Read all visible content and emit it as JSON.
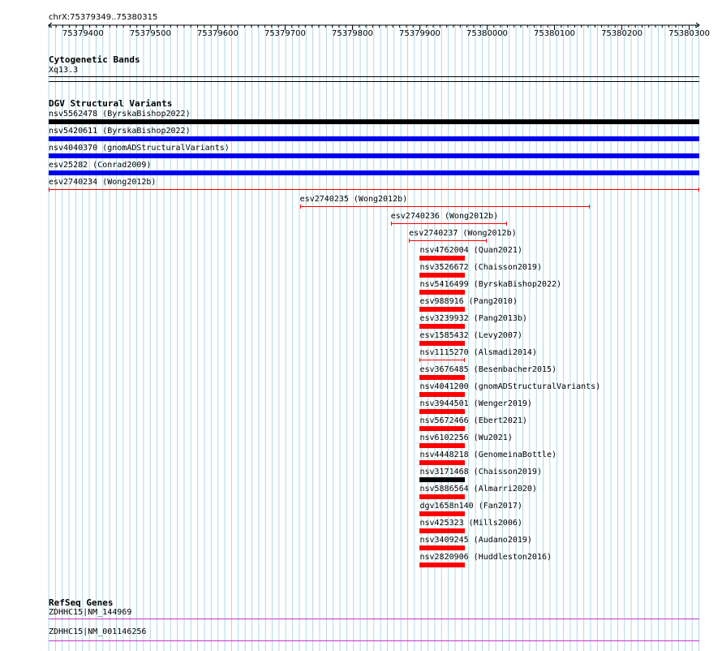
{
  "location": "chrX:75379349..75380315",
  "ruler": {
    "ticks": [
      "75379400",
      "75379500",
      "75379600",
      "75379700",
      "75379800",
      "75379900",
      "75380000",
      "75380100",
      "75380200",
      "75380300"
    ]
  },
  "colors": {
    "red": "#ff0000",
    "blue": "#0000ee",
    "black": "#000000",
    "gene": "#cc33cc",
    "grid": "#add8e6"
  },
  "tracks": {
    "cytoband": {
      "title": "Cytogenetic Bands",
      "label": "Xq13.3"
    },
    "dgv": {
      "title": "DGV Structural Variants",
      "features": [
        {
          "label": "nsv5562478 (ByrskaBishop2022)",
          "style": "thick",
          "color": "black",
          "start": 75379349,
          "end": 75380315
        },
        {
          "label": "nsv5420611 (ByrskaBishop2022)",
          "style": "thick",
          "color": "blue",
          "start": 75379349,
          "end": 75380315
        },
        {
          "label": "nsv4040370 (gnomADStructuralVariants)",
          "style": "thick",
          "color": "blue",
          "start": 75379349,
          "end": 75380315
        },
        {
          "label": "esv25282 (Conrad2009)",
          "style": "thick",
          "color": "blue",
          "start": 75379349,
          "end": 75380315
        },
        {
          "label": "esv2740234 (Wong2012b)",
          "style": "thin",
          "color": "red",
          "start": 75379349,
          "end": 75380315
        },
        {
          "label": "esv2740235 (Wong2012b)",
          "style": "thin",
          "color": "red",
          "start": 75379722,
          "end": 75380152
        },
        {
          "label": "esv2740236 (Wong2012b)",
          "style": "thin",
          "color": "red",
          "start": 75379857,
          "end": 75380030
        },
        {
          "label": "esv2740237 (Wong2012b)",
          "style": "thin",
          "color": "red",
          "start": 75379884,
          "end": 75380000
        },
        {
          "label": "nsv4762004 (Quan2021)",
          "style": "thick",
          "color": "red",
          "start": 75379900,
          "end": 75379967
        },
        {
          "label": "nsv3526672 (Chaisson2019)",
          "style": "thick",
          "color": "red",
          "start": 75379900,
          "end": 75379967
        },
        {
          "label": "nsv5416499 (ByrskaBishop2022)",
          "style": "thick",
          "color": "red",
          "start": 75379900,
          "end": 75379967
        },
        {
          "label": "esv988916 (Pang2010)",
          "style": "thick",
          "color": "red",
          "start": 75379900,
          "end": 75379967
        },
        {
          "label": "esv3239932 (Pang2013b)",
          "style": "thick",
          "color": "red",
          "start": 75379900,
          "end": 75379967
        },
        {
          "label": "esv1585432 (Levy2007)",
          "style": "thick",
          "color": "red",
          "start": 75379900,
          "end": 75379967
        },
        {
          "label": "nsv1115270 (Alsmadi2014)",
          "style": "thin",
          "color": "red",
          "start": 75379900,
          "end": 75379967
        },
        {
          "label": "esv3676485 (Besenbacher2015)",
          "style": "thick",
          "color": "red",
          "start": 75379900,
          "end": 75379967
        },
        {
          "label": "nsv4041200 (gnomADStructuralVariants)",
          "style": "thick",
          "color": "red",
          "start": 75379900,
          "end": 75379967
        },
        {
          "label": "nsv3944501 (Wenger2019)",
          "style": "thick",
          "color": "red",
          "start": 75379900,
          "end": 75379967
        },
        {
          "label": "nsv5672466 (Ebert2021)",
          "style": "thick",
          "color": "red",
          "start": 75379900,
          "end": 75379967
        },
        {
          "label": "nsv6102256 (Wu2021)",
          "style": "thick",
          "color": "red",
          "start": 75379900,
          "end": 75379967
        },
        {
          "label": "nsv4448218 (GenomeinaBottle)",
          "style": "thick",
          "color": "red",
          "start": 75379900,
          "end": 75379967
        },
        {
          "label": "nsv3171468 (Chaisson2019)",
          "style": "thick",
          "color": "black",
          "start": 75379900,
          "end": 75379967
        },
        {
          "label": "nsv5886564 (Almarri2020)",
          "style": "thick",
          "color": "red",
          "start": 75379900,
          "end": 75379967
        },
        {
          "label": "dgv1658n140 (Fan2017)",
          "style": "thick",
          "color": "red",
          "start": 75379900,
          "end": 75379967
        },
        {
          "label": "nsv425323 (Mills2006)",
          "style": "thick",
          "color": "red",
          "start": 75379900,
          "end": 75379967
        },
        {
          "label": "nsv3409245 (Audano2019)",
          "style": "thick",
          "color": "red",
          "start": 75379900,
          "end": 75379967
        },
        {
          "label": "nsv2820906 (Huddleston2016)",
          "style": "thick",
          "color": "red",
          "start": 75379900,
          "end": 75379967
        }
      ]
    },
    "refseq": {
      "title": "RefSeq Genes",
      "features": [
        {
          "label": "ZDHHC15|NM_144969"
        },
        {
          "label": "ZDHHC15|NM_001146256"
        }
      ]
    }
  }
}
